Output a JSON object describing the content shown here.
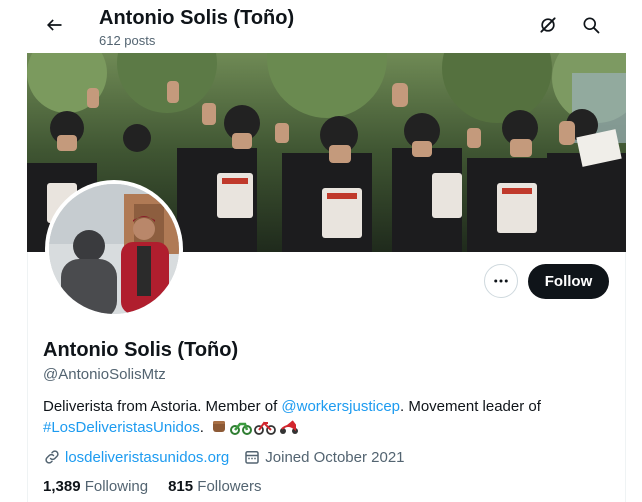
{
  "header": {
    "title": "Antonio Solis (Toño)",
    "posts_count": "612 posts",
    "icons": [
      "back-arrow-icon",
      "grok-icon",
      "search-icon"
    ]
  },
  "profile": {
    "name": "Antonio Solis (Toño)",
    "handle": "@AntonioSolisMtz",
    "bio": {
      "part1": "Deliverista from Astoria. Member of ",
      "mention": "@workersjusticep",
      "part2": ". Movement leader of ",
      "hashtag": "#LosDeliveristasUnidos",
      "part3": ". ",
      "emojis": [
        "raised-fist-icon",
        "motorcycle-icon",
        "bicycle-icon",
        "scooter-icon"
      ]
    },
    "website": "losdeliveristasunidos.org",
    "joined": "Joined October 2021",
    "following_count": "1,389",
    "following_label": "Following",
    "followers_count": "815",
    "followers_label": "Followers"
  },
  "actions": {
    "follow_label": "Follow",
    "more_icon": "more-dots-icon"
  },
  "colors": {
    "link": "#1d9bf0",
    "text": "#0f1419",
    "secondary": "#536471",
    "follow_bg": "#0f1419"
  }
}
